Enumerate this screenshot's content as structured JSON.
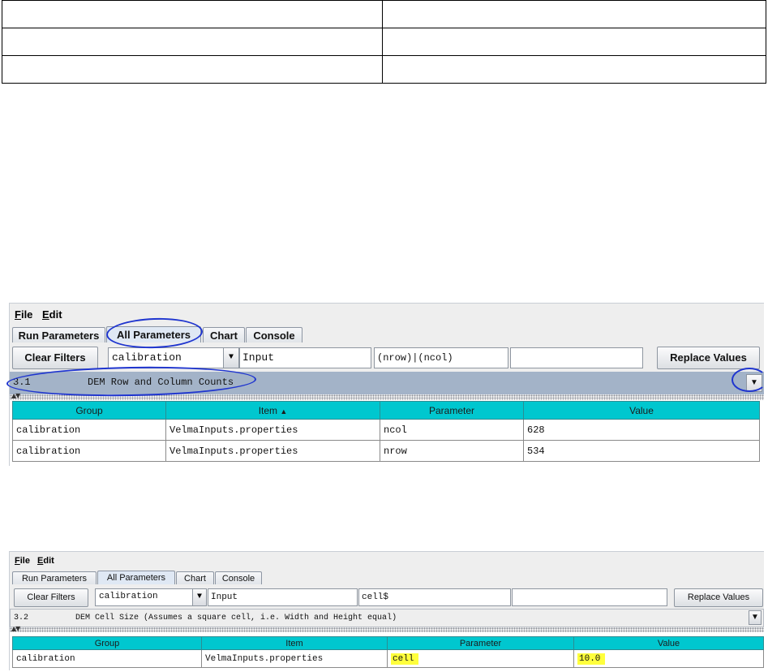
{
  "top_table": {
    "rows": 3,
    "cols": 2
  },
  "screenshot1": {
    "menu": {
      "file": "File",
      "edit": "Edit"
    },
    "tabs": [
      "Run Parameters",
      "All Parameters",
      "Chart",
      "Console"
    ],
    "active_tab": "All Parameters",
    "clear_filters_label": "Clear Filters",
    "group_combo_value": "calibration",
    "item_filter": "Input",
    "parameter_filter": "(nrow)|(ncol)",
    "value_filter": "",
    "replace_values_label": "Replace Values",
    "description_number": "3.1",
    "description_text": "DEM Row and Column Counts",
    "columns": [
      "Group",
      "Item",
      "Parameter",
      "Value"
    ],
    "sort_indicator": "▲",
    "rows": [
      {
        "group": "calibration",
        "item": "VelmaInputs.properties",
        "parameter": "ncol",
        "value": "628"
      },
      {
        "group": "calibration",
        "item": "VelmaInputs.properties",
        "parameter": "nrow",
        "value": "534"
      }
    ]
  },
  "screenshot2": {
    "menu": {
      "file": "File",
      "edit": "Edit"
    },
    "tabs": [
      "Run Parameters",
      "All Parameters",
      "Chart",
      "Console"
    ],
    "active_tab": "All Parameters",
    "clear_filters_label": "Clear Filters",
    "group_combo_value": "calibration",
    "item_filter": "Input",
    "parameter_filter": "cell$",
    "value_filter": "",
    "replace_values_label": "Replace Values",
    "description_number": "3.2",
    "description_text": "DEM Cell Size (Assumes a square cell, i.e. Width and Height equal)",
    "columns": [
      "Group",
      "Item",
      "Parameter",
      "Value"
    ],
    "rows": [
      {
        "group": "calibration",
        "item": "VelmaInputs.properties",
        "parameter": "cell",
        "value": "10.0"
      }
    ]
  },
  "colors": {
    "header_teal": "#00c7cf",
    "annotation_blue": "#1f35cf",
    "highlight_yellow": "#ffff3c",
    "description_bar_1": "#a3b3c8",
    "description_bar_2": "#eeeeee"
  },
  "icons": {
    "combo_arrow": "triangle-down-icon",
    "splitter": "collapse-arrows-icon"
  }
}
